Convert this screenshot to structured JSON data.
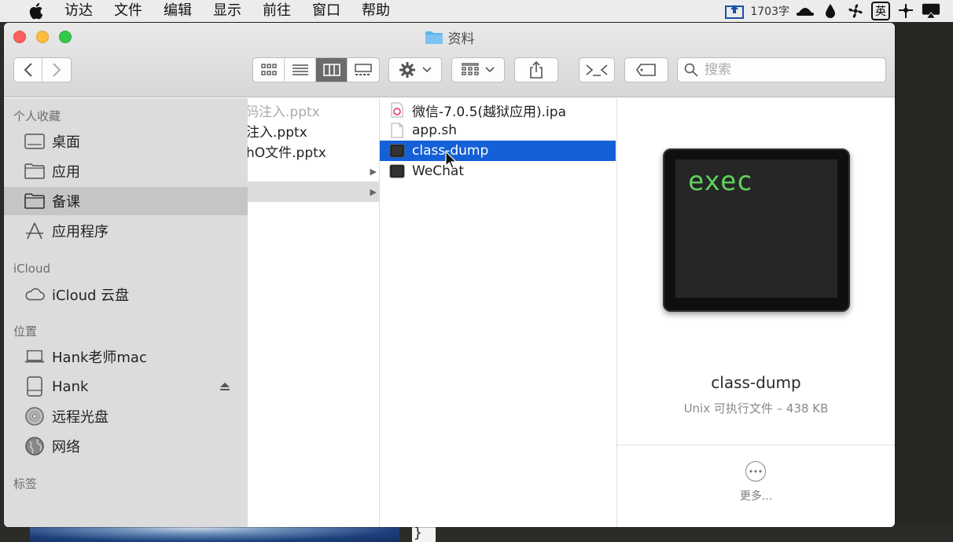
{
  "menubar": {
    "items": [
      "访达",
      "文件",
      "编辑",
      "显示",
      "前往",
      "窗口",
      "帮助"
    ],
    "status_text": "1703字",
    "ime_label": "英"
  },
  "window": {
    "title": "资料"
  },
  "toolbar": {
    "search_placeholder": "搜索"
  },
  "sidebar": {
    "sections": {
      "favorites": "个人收藏",
      "icloud": "iCloud",
      "locations": "位置",
      "tags": "标签"
    },
    "favorites": [
      "桌面",
      "应用",
      "备课",
      "应用程序"
    ],
    "icloud_items": [
      "iCloud 云盘"
    ],
    "locations": [
      "Hank老师mac",
      "Hank",
      "远程光盘",
      "网络"
    ],
    "selected": "备课"
  },
  "column1": {
    "rows": [
      "码注入.pptx",
      "注入.pptx",
      "hO文件.pptx"
    ]
  },
  "column2": {
    "rows": [
      "微信-7.0.5(越狱应用).ipa",
      "app.sh",
      "class-dump",
      "WeChat"
    ],
    "selected": "class-dump"
  },
  "preview": {
    "icon_text": "exec",
    "name": "class-dump",
    "info": "Unix 可执行文件 – 438 KB",
    "more_label": "更多..."
  },
  "desktop": {
    "brace": "}"
  },
  "colors": {
    "selection": "#1560d6",
    "exec_green": "#5fd05d"
  }
}
